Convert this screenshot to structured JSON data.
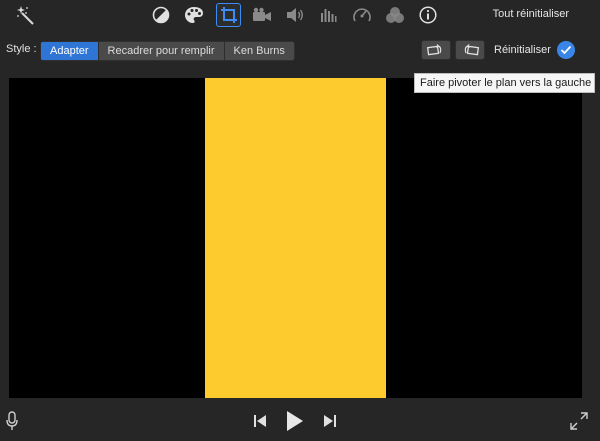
{
  "toolbar": {
    "reset_all_label": "Tout réinitialiser",
    "icons": [
      "magic-wand-icon",
      "color-balance-icon",
      "palette-icon",
      "crop-icon",
      "video-camera-icon",
      "volume-icon",
      "equalizer-icon",
      "speedometer-icon",
      "filter-icon",
      "info-icon"
    ],
    "active_icon": "crop-icon"
  },
  "style_row": {
    "label": "Style :",
    "options": [
      "Adapter",
      "Recadrer pour remplir",
      "Ken Burns"
    ],
    "selected": "Adapter",
    "reset_label": "Réinitialiser"
  },
  "tooltip": {
    "text": "Faire pivoter le plan vers la gauche"
  },
  "colors": {
    "background": "#262626",
    "accent": "#2f75d6",
    "frame": "#fecb2e",
    "viewer": "#000000"
  },
  "controls": {
    "icons": [
      "microphone-icon",
      "skip-back-icon",
      "play-icon",
      "skip-forward-icon",
      "fullscreen-icon"
    ]
  }
}
